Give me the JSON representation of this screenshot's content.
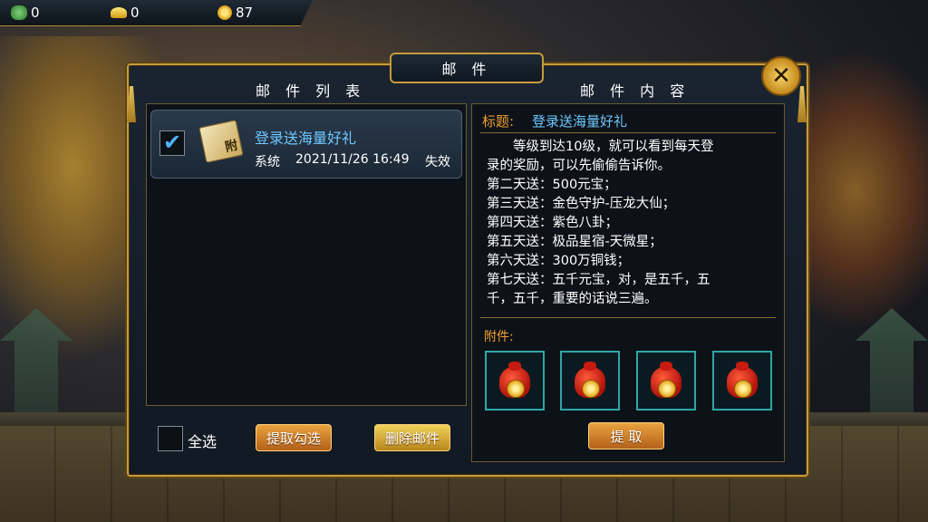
{
  "currencies": [
    {
      "icon": "jade-icon",
      "value": "0"
    },
    {
      "icon": "gold-ingot-icon",
      "value": "0"
    },
    {
      "icon": "copper-coin-icon",
      "value": "87"
    }
  ],
  "window_title": "邮 件",
  "list_title": "邮 件 列 表",
  "content_title": "邮 件 内 容",
  "mails": [
    {
      "subject": "登录送海量好礼",
      "sender": "系统",
      "datetime": "2021/11/26  16:49",
      "status": "失效",
      "checked": true,
      "attachment_badge": "附"
    }
  ],
  "detail": {
    "subject_label": "标题:",
    "subject": "登录送海量好礼",
    "body_lines": [
      "　　等级到达10级，就可以看到每天登",
      "录的奖励，可以先偷偷告诉你。",
      "第二天送：500元宝；",
      "第三天送：金色守护-压龙大仙；",
      "第四天送：紫色八卦；",
      "第五天送：极品星宿-天微星；",
      "第六天送：300万铜钱；",
      "第七天送：五千元宝，对，是五千，五",
      "千，五千，重要的话说三遍。"
    ],
    "attachments_label": "附件:",
    "attachments": [
      {
        "icon": "red-money-bag-icon"
      },
      {
        "icon": "red-money-bag-icon"
      },
      {
        "icon": "red-money-bag-icon"
      },
      {
        "icon": "red-money-bag-icon"
      }
    ],
    "claim_button": "提  取"
  },
  "footer": {
    "select_all": "全选",
    "claim_checked": "提取勾选",
    "delete_mail": "删除邮件"
  },
  "check_mark": "✔",
  "close_glyph": "✕"
}
